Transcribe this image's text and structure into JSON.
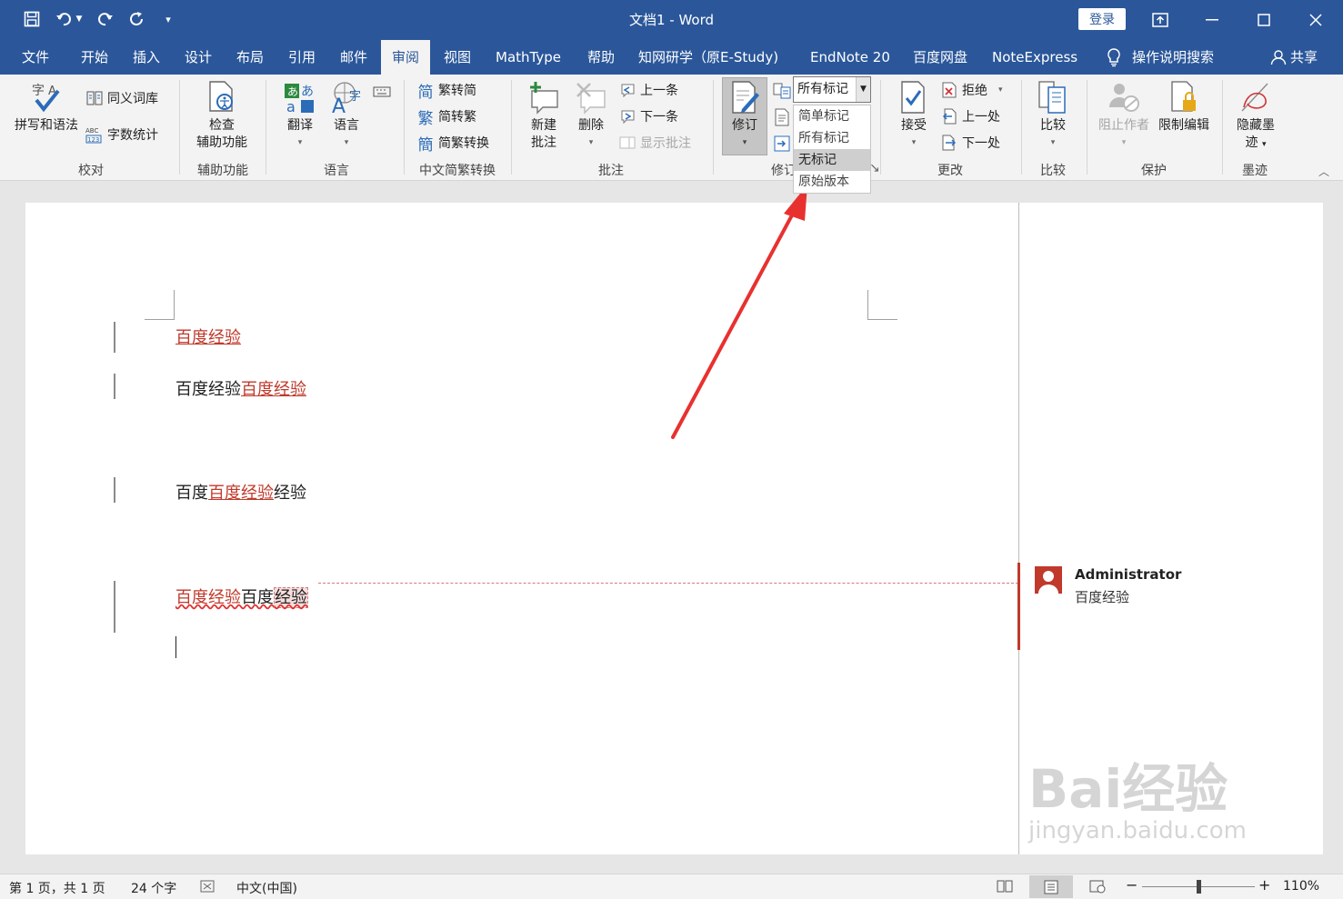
{
  "window": {
    "title": "文档1  -  Word",
    "login": "登录"
  },
  "tabs": [
    "文件",
    "开始",
    "插入",
    "设计",
    "布局",
    "引用",
    "邮件",
    "审阅",
    "视图",
    "MathType",
    "帮助",
    "知网研学（原E-Study)",
    "EndNote 20",
    "百度网盘",
    "NoteExpress"
  ],
  "active_tab": "审阅",
  "tell_me": "操作说明搜索",
  "share": "共享",
  "ribbon": {
    "proofing": {
      "spelling": "拼写和语法",
      "thesaurus": "同义词库",
      "word_count": "字数统计",
      "label": "校对"
    },
    "accessibility": {
      "check_line1": "检查",
      "check_line2": "辅助功能",
      "label": "辅助功能"
    },
    "language": {
      "translate": "翻译",
      "language": "语言",
      "label": "语言"
    },
    "chinese": {
      "t2s": "繁转简",
      "s2t": "简转繁",
      "convert": "简繁转换",
      "label": "中文简繁转换"
    },
    "comments": {
      "new_line1": "新建",
      "new_line2": "批注",
      "delete": "删除",
      "prev": "上一条",
      "next": "下一条",
      "show": "显示批注",
      "label": "批注"
    },
    "tracking": {
      "track": "修订",
      "label": "修订",
      "markup_value": "所有标记",
      "options": [
        "简单标记",
        "所有标记",
        "无标记",
        "原始版本"
      ],
      "selected_option": "无标记"
    },
    "changes": {
      "accept": "接受",
      "reject": "拒绝",
      "prev": "上一处",
      "next": "下一处",
      "label": "更改"
    },
    "compare": {
      "compare": "比较",
      "label": "比较"
    },
    "protect": {
      "block": "阻止作者",
      "restrict": "限制编辑",
      "label": "保护"
    },
    "ink": {
      "hide_line1": "隐藏墨",
      "hide_line2": "迹",
      "label": "墨迹"
    }
  },
  "document": {
    "para1": {
      "inserted": "百度经验"
    },
    "para2": {
      "plain": "百度经验",
      "inserted": "百度经验"
    },
    "para3": {
      "plain_before": "百度",
      "inserted": "百度经验",
      "plain_after": "经验"
    },
    "para4": {
      "inserted": "百度经验",
      "plain": "百度",
      "commented": "经验"
    }
  },
  "comment": {
    "author": "Administrator",
    "text": "百度经验"
  },
  "status": {
    "page": "第 1 页，共 1 页",
    "words": "24 个字",
    "language": "中文(中国)",
    "zoom": "110%"
  },
  "watermark": {
    "brand": "Bai经验",
    "url": "jingyan.baidu.com"
  },
  "colors": {
    "titlebar": "#2b579a",
    "revision": "#c0392b",
    "ribbon": "#f3f3f3",
    "arrow": "#e8312f"
  }
}
